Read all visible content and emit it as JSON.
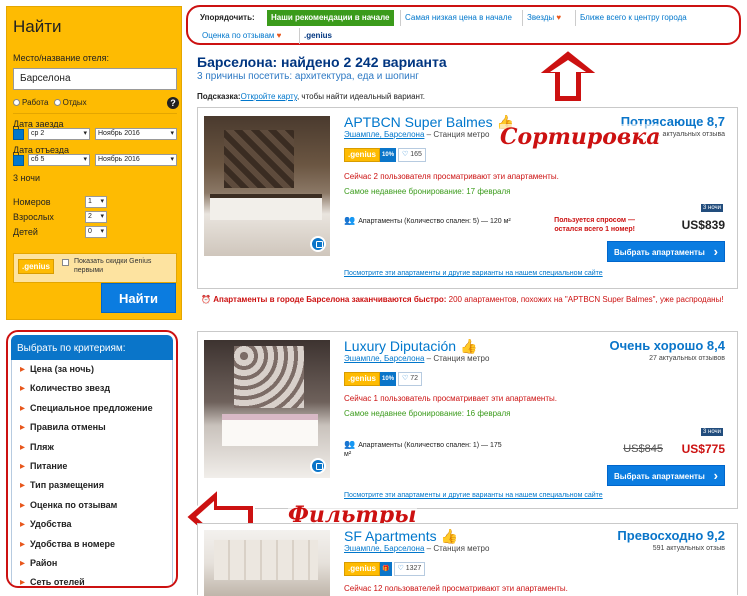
{
  "search": {
    "title": "Найти",
    "dest_label": "Место/название отеля:",
    "dest_value": "Барселона",
    "purpose_work": "Работа",
    "purpose_leisure": "Отдых",
    "help": "?",
    "checkin_label": "Дата заезда",
    "checkin_day": "ср 2",
    "checkin_month": "Ноябрь 2016",
    "checkout_label": "Дата отъезда",
    "checkout_day": "сб 5",
    "checkout_month": "Ноябрь 2016",
    "nights": "3 ночи",
    "rooms_label": "Номеров",
    "rooms_value": "1",
    "adults_label": "Взрослых",
    "adults_value": "2",
    "children_label": "Детей",
    "children_value": "0",
    "genius_badge": ".genius",
    "genius_text": "Показать скидки Genius первыми",
    "button": "Найти"
  },
  "filters": {
    "header": "Выбрать по критериям:",
    "items": [
      "Цена (за ночь)",
      "Количество звезд",
      "Специальное предложение",
      "Правила отмены",
      "Пляж",
      "Питание",
      "Тип размещения",
      "Оценка по отзывам",
      "Удобства",
      "Удобства в номере",
      "Район",
      "Сеть отелей"
    ]
  },
  "sort": {
    "label": "Упорядочить:",
    "options": [
      "Наши рекомендации в начале",
      "Самая низкая цена в начале",
      "Звезды",
      "Ближе всего к центру города",
      "Оценка по отзывам",
      ".genius"
    ]
  },
  "results": {
    "title": "Барселона: найдено 2 242 варианта",
    "reasons": "3 причины посетить: архитектура, еда и шопинг",
    "hint_prefix": "Подсказка:",
    "hint_link": "Откройте карту",
    "hint_suffix": ", чтобы найти идеальный вариант."
  },
  "hotels": [
    {
      "name": "APTBCN Super Balmes",
      "district": "Эшампле, Барселона",
      "metro": "– Станция метро",
      "rating_text": "Потрясающе 8,7",
      "reviews": "... актуальных отзыва",
      "genius": ".genius",
      "discount": "10%",
      "likes": "165",
      "viewers": "Сейчас 2 пользователя просматривают эти апартаменты.",
      "recent": "Самое недавнее бронирование: 17 февраля",
      "apt_desc": "Апартаменты (Количество спален: 5) — 120 м²",
      "demand": "Пользуется спросом — осталcя всего 1 номер!",
      "nights": "3 ночи",
      "price": "US$839",
      "button": "Выбрать апартаменты",
      "more_link": "Посмотрите эти апартаменты и другие варианты на нашем специальном сайте",
      "alert_bold": "Апартаменты в городе Барселона заканчиваются быстро:",
      "alert_rest": "200 апартаментов, похожих на \"APTBCN Super Balmes\", уже распроданы!"
    },
    {
      "name": "Luxury Diputación",
      "district": "Эшампле, Барселона",
      "metro": "– Станция метро",
      "rating_text": "Очень хорошо 8,4",
      "reviews": "27 актуальных отзывов",
      "genius": ".genius",
      "discount": "10%",
      "likes": "72",
      "viewers": "Сейчас 1 пользователь просматривает эти апартаменты.",
      "recent": "Самое недавнее бронирование: 16 февраля",
      "apt_desc": "Апартаменты (Количество спален: 1) — 175 м²",
      "nights": "3 ночи",
      "old_price": "US$845",
      "price": "US$775",
      "button": "Выбрать апартаменты",
      "more_link": "Посмотрите эти апартаменты и другие варианты на нашем специальном сайте"
    },
    {
      "name": "SF Apartments",
      "district": "Эшампле, Барселона",
      "metro": "– Станция метро",
      "rating_text": "Превосходно 9,2",
      "reviews": "591 актуальных отзыв",
      "genius": ".genius",
      "likes": "1327",
      "viewers": "Сейчас 12 пользователей просматривают эти апартаменты."
    }
  ],
  "annotations": {
    "sort": "Сортировка",
    "filters": "Фильтры"
  },
  "colors": {
    "accent": "#febb02",
    "brand": "#003580",
    "link": "#0077cc",
    "annotation": "#cc1111",
    "active_sort": "#3b9b1b"
  }
}
